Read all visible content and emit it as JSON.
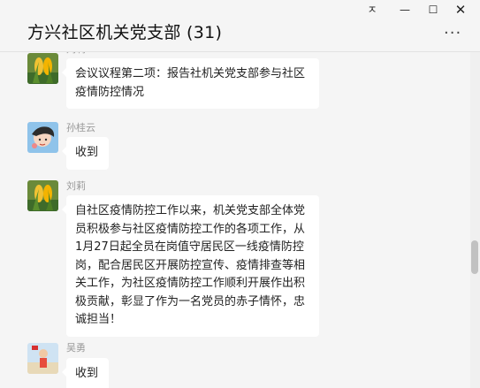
{
  "window": {
    "title": "方兴社区机关党支部 (31)",
    "controls": {
      "pin": "ㅈ",
      "minimize": "—",
      "maximize": "☐",
      "close": "✕"
    },
    "more": "···"
  },
  "messages": [
    {
      "sender": "刘莉",
      "text": "会议议程第二项：报告社机关党支部参与社区疫情防控情况",
      "avatar": "corn-avatar"
    },
    {
      "sender": "孙桂云",
      "text": "收到",
      "avatar": "cartoon-girl-avatar"
    },
    {
      "sender": "刘莉",
      "text": "自社区疫情防控工作以来，机关党支部全体党员积极参与社区疫情防控工作的各项工作，从1月27日起全员在岗值守居民区一线疫情防控岗，配合居民区开展防控宣传、疫情排查等相关工作，为社区疫情防控工作顺利开展作出积极贡献，彰显了作为一名党员的赤子情怀，忠诚担当！",
      "avatar": "corn-avatar"
    },
    {
      "sender": "吴勇",
      "text": "收到",
      "avatar": "child-beach-avatar"
    }
  ],
  "colors": {
    "background": "#f5f5f5",
    "bubble": "#ffffff",
    "name": "#999999"
  }
}
